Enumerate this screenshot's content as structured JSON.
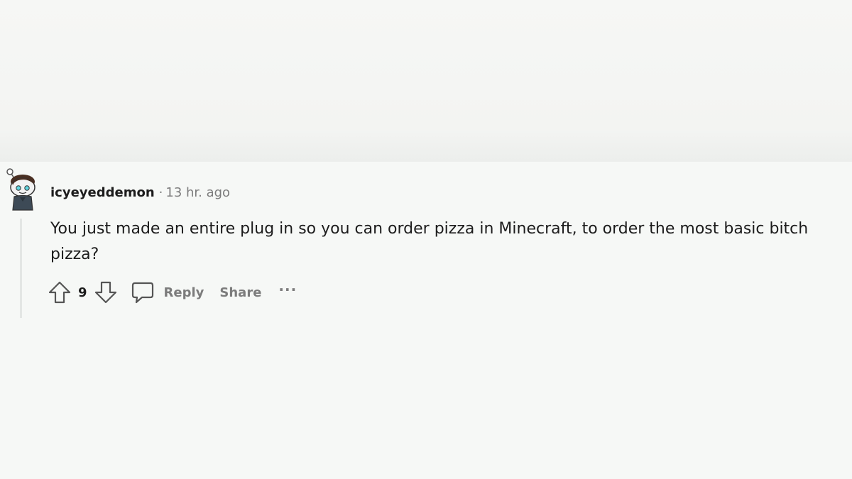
{
  "comment": {
    "author": "icyeyeddemon",
    "separator": "·",
    "time": "13 hr. ago",
    "body": "You just made an entire plug in so you can order pizza in Minecraft, to order the most basic bitch pizza?",
    "score": "9",
    "reply_label": "Reply",
    "share_label": "Share",
    "more_label": "···"
  },
  "icons": {
    "upvote": "upvote-arrow-icon",
    "downvote": "downvote-arrow-icon",
    "reply": "speech-bubble-icon",
    "more": "ellipsis-icon",
    "avatar": "snoo-avatar-icon"
  },
  "colors": {
    "text_primary": "#1c1c1c",
    "text_secondary": "#7c7c7c",
    "background": "#f6f8f6"
  }
}
